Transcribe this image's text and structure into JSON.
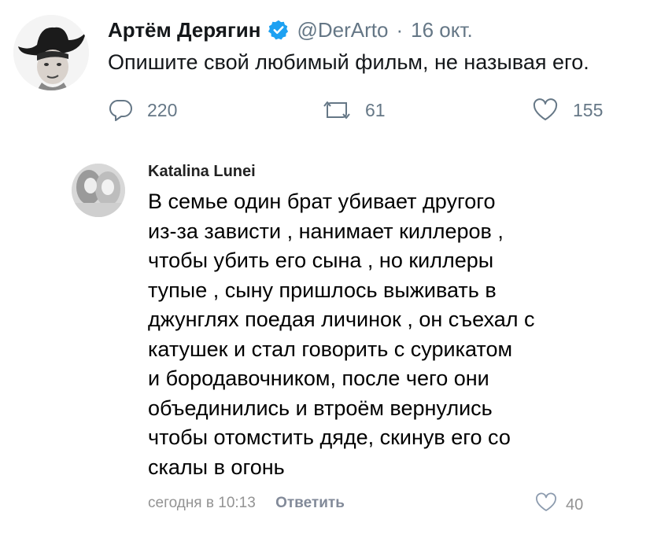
{
  "tweet": {
    "author_name": "Артём Дерягин",
    "handle": "@DerArto",
    "separator": "·",
    "date": "16 окт.",
    "text": "Опишите свой любимый фильм, не называя его.",
    "replies": "220",
    "retweets": "61",
    "likes": "155",
    "verified_color": "#1da1f2",
    "icon_color": "#657786"
  },
  "comment": {
    "author": "Katalina Lunei",
    "lines": [
      "В семье один брат убивает другого",
      "из-за зависти , нанимает киллеров ,",
      "чтобы убить его сына , но киллеры",
      "тупые , сыну пришлось выживать в",
      "джунглях поедая личинок , он съехал с",
      "катушек и стал говорить с сурикатом",
      "и бородавочником, после чего они",
      "объединились и втроём вернулись",
      "чтобы отомстить дяде, скинув его со",
      "скалы в огонь"
    ],
    "timestamp": "сегодня в 10:13",
    "reply_label": "Ответить",
    "likes": "40"
  }
}
